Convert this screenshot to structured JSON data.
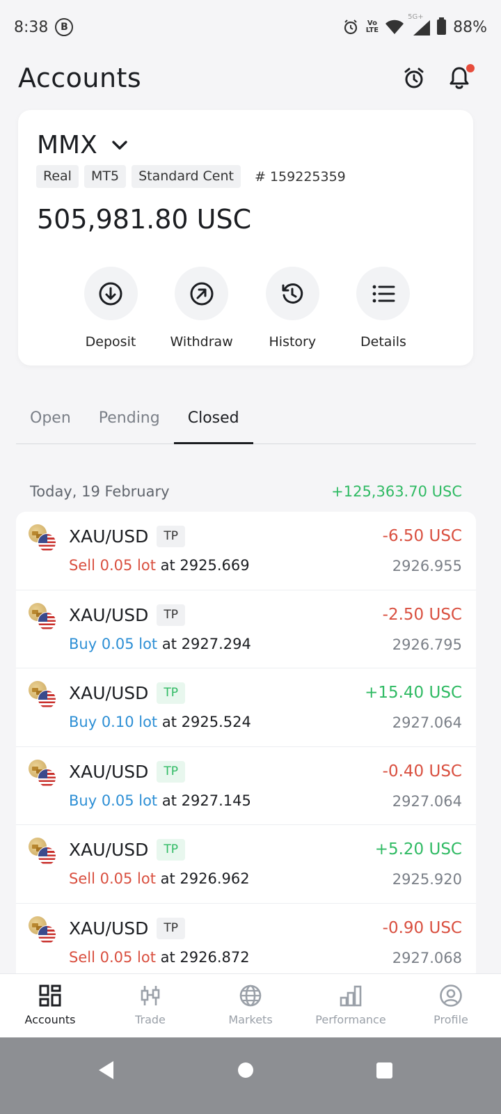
{
  "status_bar": {
    "time": "8:38",
    "b_badge": "B",
    "volte_top": "Vo",
    "volte_bottom": "LTE",
    "network": "5G+",
    "battery": "88%"
  },
  "header": {
    "title": "Accounts"
  },
  "account": {
    "name": "MMX",
    "tags": [
      "Real",
      "MT5",
      "Standard Cent"
    ],
    "number": "# 159225359",
    "balance": "505,981.80 USC",
    "actions": [
      {
        "label": "Deposit",
        "icon": "arrow-down-circle-icon"
      },
      {
        "label": "Withdraw",
        "icon": "arrow-up-right-circle-icon"
      },
      {
        "label": "History",
        "icon": "history-icon"
      },
      {
        "label": "Details",
        "icon": "list-icon"
      }
    ]
  },
  "tabs": [
    "Open",
    "Pending",
    "Closed"
  ],
  "active_tab": "Closed",
  "day_group": {
    "label": "Today, 19 February",
    "total": "+125,363.70 USC"
  },
  "trades": [
    {
      "symbol": "XAU/USD",
      "tag": "TP",
      "tag_green": false,
      "side": "Sell 0.05 lot",
      "at": " at 2925.669",
      "pnl": "-6.50 USC",
      "pnl_positive": false,
      "close": "2926.955"
    },
    {
      "symbol": "XAU/USD",
      "tag": "TP",
      "tag_green": false,
      "side": "Buy 0.05 lot",
      "at": " at 2927.294",
      "pnl": "-2.50 USC",
      "pnl_positive": false,
      "close": "2926.795"
    },
    {
      "symbol": "XAU/USD",
      "tag": "TP",
      "tag_green": true,
      "side": "Buy 0.10 lot",
      "at": " at 2925.524",
      "pnl": "+15.40 USC",
      "pnl_positive": true,
      "close": "2927.064"
    },
    {
      "symbol": "XAU/USD",
      "tag": "TP",
      "tag_green": true,
      "side": "Buy 0.05 lot",
      "at": " at 2927.145",
      "pnl": "-0.40 USC",
      "pnl_positive": false,
      "close": "2927.064"
    },
    {
      "symbol": "XAU/USD",
      "tag": "TP",
      "tag_green": true,
      "side": "Sell 0.05 lot",
      "at": " at 2926.962",
      "pnl": "+5.20 USC",
      "pnl_positive": true,
      "close": "2925.920"
    },
    {
      "symbol": "XAU/USD",
      "tag": "TP",
      "tag_green": false,
      "side": "Sell 0.05 lot",
      "at": " at 2926.872",
      "pnl": "-0.90 USC",
      "pnl_positive": false,
      "close": "2927.068"
    }
  ],
  "bottom_nav": [
    {
      "label": "Accounts",
      "icon": "accounts-grid-icon",
      "active": true
    },
    {
      "label": "Trade",
      "icon": "candlestick-icon",
      "active": false
    },
    {
      "label": "Markets",
      "icon": "globe-icon",
      "active": false
    },
    {
      "label": "Performance",
      "icon": "bar-chart-icon",
      "active": false
    },
    {
      "label": "Profile",
      "icon": "profile-icon",
      "active": false
    }
  ],
  "colors": {
    "positive": "#2fba63",
    "negative": "#d94f3f",
    "buy": "#2d8fd5",
    "accent": "#1b1d21"
  }
}
